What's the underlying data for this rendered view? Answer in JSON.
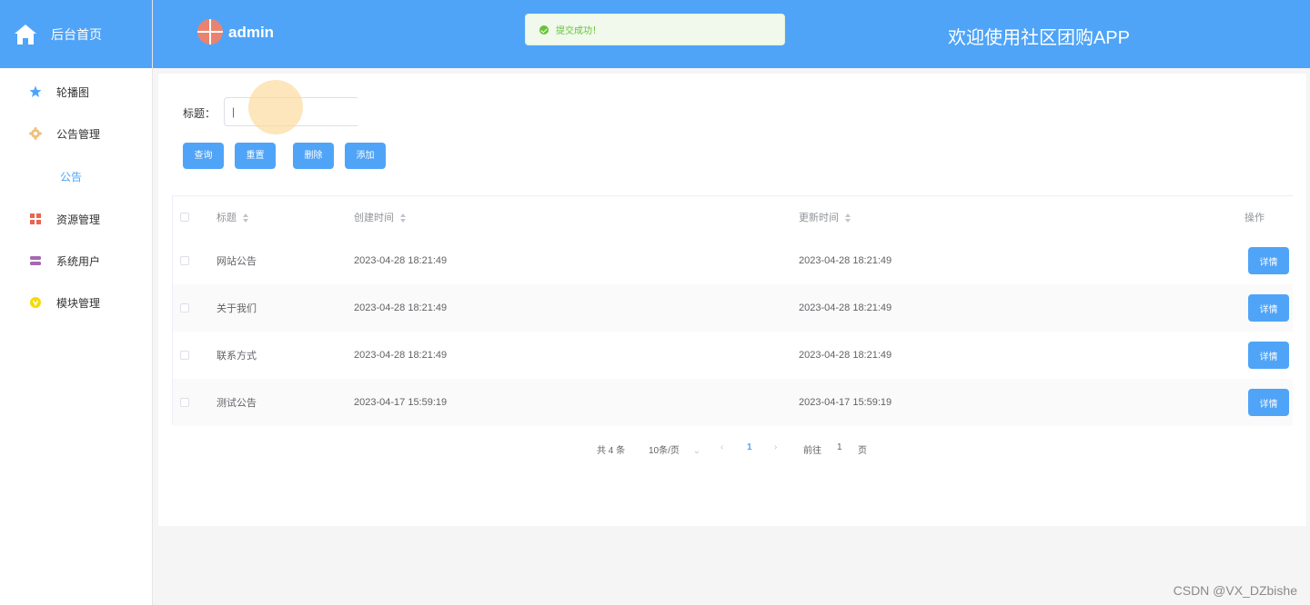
{
  "sidebar": {
    "brand": "后台首页",
    "items": [
      {
        "label": "轮播图",
        "icon": "star-icon",
        "color": "#4fa4f8"
      },
      {
        "label": "公告管理",
        "icon": "gear-icon",
        "color": "#f0ad4e"
      },
      {
        "label": "资源管理",
        "icon": "grid-icon",
        "color": "#e8654f"
      },
      {
        "label": "系统用户",
        "icon": "user-group-icon",
        "color": "#9b59b6"
      },
      {
        "label": "模块管理",
        "icon": "module-icon",
        "color": "#f5d90a"
      }
    ],
    "subitem": "公告"
  },
  "header": {
    "user": "admin",
    "welcome": "欢迎使用社区团购APP"
  },
  "toast": {
    "message": "提交成功！"
  },
  "search": {
    "label": "标题：",
    "value": "|"
  },
  "buttons": {
    "query": "查询",
    "reset": "重置",
    "delete": "删除",
    "add": "添加"
  },
  "table": {
    "headers": {
      "title": "标题",
      "created": "创建时间",
      "updated": "更新时间",
      "actions": "操作"
    },
    "rows": [
      {
        "title": "网站公告",
        "created": "2023-04-28 18:21:49",
        "updated": "2023-04-28 18:21:49"
      },
      {
        "title": "关于我们",
        "created": "2023-04-28 18:21:49",
        "updated": "2023-04-28 18:21:49"
      },
      {
        "title": "联系方式",
        "created": "2023-04-28 18:21:49",
        "updated": "2023-04-28 18:21:49"
      },
      {
        "title": "测试公告",
        "created": "2023-04-17 15:59:19",
        "updated": "2023-04-17 15:59:19"
      }
    ],
    "detail_label": "详情"
  },
  "pager": {
    "total": "共 4 条",
    "page_size": "10条/页",
    "current": "1",
    "goto_label": "前往",
    "goto_value": "1",
    "page_suffix": "页"
  },
  "watermark": "CSDN @VX_DZbishe",
  "colors": {
    "primary": "#4fa4f8",
    "success": "#67c23a"
  }
}
